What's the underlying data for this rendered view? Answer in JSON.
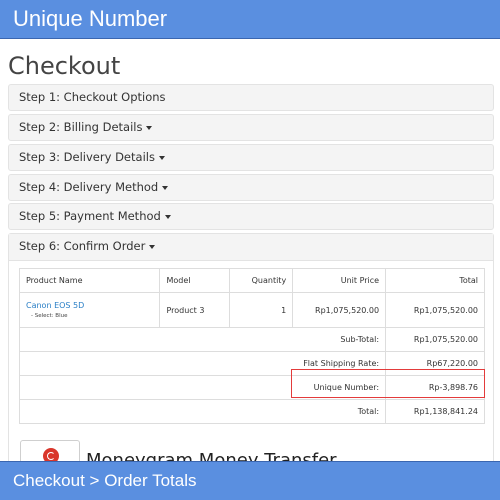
{
  "banner": {
    "top_title": "Unique Number",
    "bottom_caption": "Checkout > Order Totals"
  },
  "page": {
    "title": "Checkout"
  },
  "steps": [
    {
      "label": "Step 1: Checkout Options"
    },
    {
      "label": "Step 2: Billing Details"
    },
    {
      "label": "Step 3: Delivery Details"
    },
    {
      "label": "Step 4: Delivery Method"
    },
    {
      "label": "Step 5: Payment Method"
    },
    {
      "label": "Step 6: Confirm Order"
    }
  ],
  "order_table": {
    "headers": [
      "Product Name",
      "Model",
      "Quantity",
      "Unit Price",
      "Total"
    ],
    "product": {
      "name": "Canon EOS 5D",
      "option": "- Select: Blue",
      "model": "Product 3",
      "quantity": "1",
      "unit_price": "Rp1,075,520.00",
      "total": "Rp1,075,520.00"
    },
    "totals": [
      {
        "label": "Sub-Total:",
        "value": "Rp1,075,520.00"
      },
      {
        "label": "Flat Shipping Rate:",
        "value": "Rp67,220.00"
      },
      {
        "label": "Unique Number:",
        "value": "Rp-3,898.76"
      },
      {
        "label": "Total:",
        "value": "Rp1,138,841.24"
      }
    ]
  },
  "payment": {
    "method_name": "Moneygram Money Transfer"
  },
  "colors": {
    "banner": "#5a8fe0",
    "link": "#2a7fc6",
    "highlight": "#e33b3b"
  }
}
